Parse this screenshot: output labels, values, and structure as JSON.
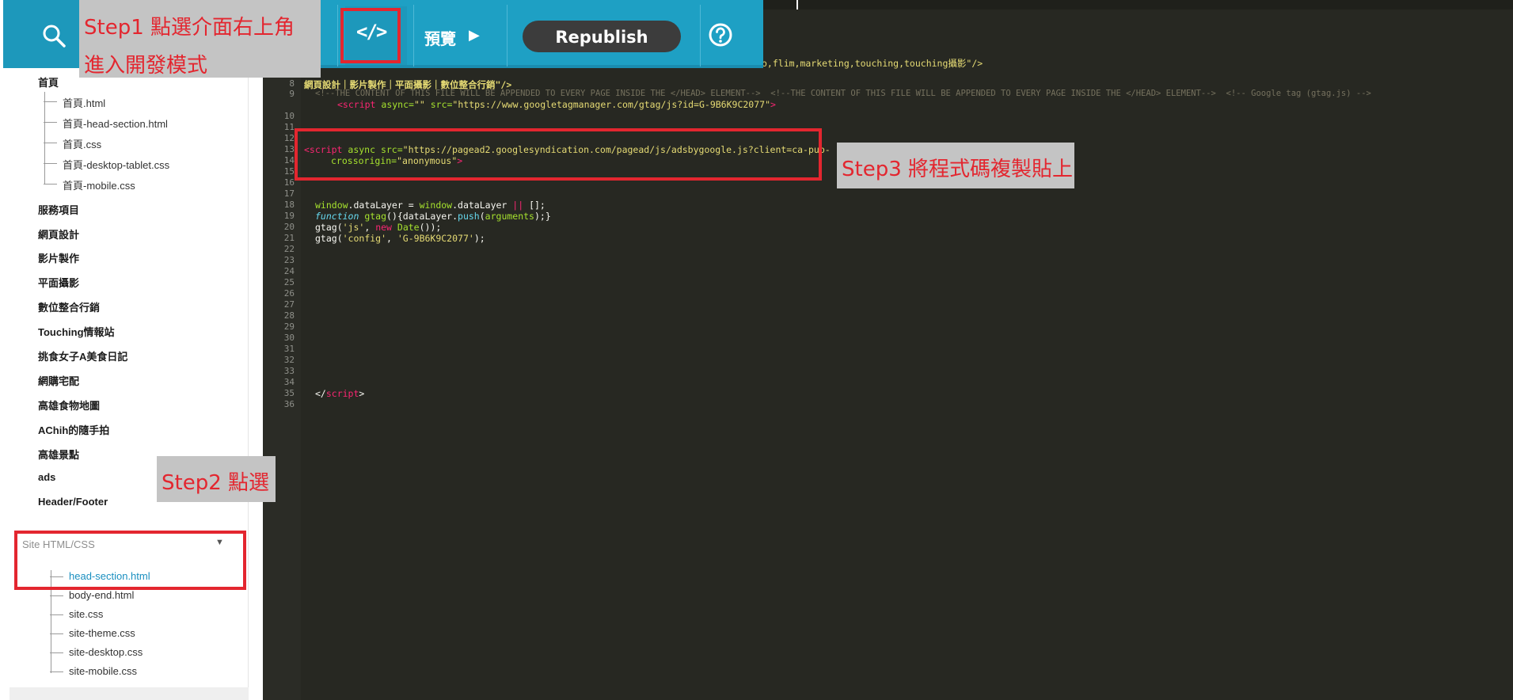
{
  "toolbar": {
    "preview_label": "預覽",
    "republish_label": "Republish"
  },
  "sidebar": {
    "home_label": "首頁",
    "home_files": [
      "首頁.html",
      "首頁-head-section.html",
      "首頁.css",
      "首頁-desktop-tablet.css",
      "首頁-mobile.css"
    ],
    "nav_items": [
      "服務項目",
      "網頁設計",
      "影片製作",
      "平面攝影",
      "數位整合行銷",
      "Touching情報站",
      "挑食女子A美食日記",
      "網購宅配",
      "高雄食物地圖",
      "AChih的隨手拍",
      "高雄景點",
      "ads",
      "Header/Footer"
    ],
    "site_section_label": "Site HTML/CSS",
    "site_files": [
      "head-section.html",
      "body-end.html",
      "site.css",
      "site-theme.css",
      "site-desktop.css",
      "site-mobile.css"
    ],
    "active_file": "head-section.html"
  },
  "annotations": {
    "step1_line1": "Step1 點選介面右上角",
    "step1_line2": "進入開發模式",
    "step2": "Step2 點選",
    "step3": "Step3 將程式碼複製貼上"
  },
  "editor": {
    "line_numbers": [
      "8",
      "9",
      "10",
      "11",
      "12",
      "13",
      "14",
      "15",
      "16",
      "17",
      "18",
      "19",
      "20",
      "21",
      "22",
      "23",
      "24",
      "25",
      "26",
      "27",
      "28",
      "29",
      "30",
      "31",
      "32",
      "33",
      "34",
      "35",
      "36"
    ],
    "line7_tail": "o,flim,marketing,touching,touching攝影\"/>",
    "line8_text": "網頁設計｜影片製作｜平面攝影｜數位整合行銷\"/>",
    "line9_comment": "<!--THE CONTENT OF THIS FILE WILL BE APPENDED TO EVERY PAGE INSIDE THE </HEAD> ELEMENT-->  <!--THE CONTENT OF THIS FILE WILL BE APPENDED TO EVERY PAGE INSIDE THE </HEAD> ELEMENT-->  <!-- Google tag (gtag.js) -->",
    "line9b": {
      "tag": "<script",
      "attr_async": " async=",
      "async_val": "\"\"",
      "attr_src": " src=",
      "src_val": "\"https://www.googletagmanager.com/gtag/js?id=G-9B6K9C2077\"",
      "close": ">"
    },
    "line13": {
      "tag": "<script",
      "attr_async": " async",
      "attr_src": " src=",
      "src_val": "\"https://pagead2.googlesyndication.com/pagead/js/adsbygoogle.js?client=ca-pub-"
    },
    "line14": {
      "attr": "crossorigin=",
      "val": "\"anonymous\"",
      "close": ">"
    },
    "line18": {
      "a": "window",
      "b": ".dataLayer = ",
      "c": "window",
      "d": ".dataLayer ",
      "e": "||",
      "f": " [];"
    },
    "line19": {
      "kw": "function",
      "fn": " gtag",
      "rest1": "(){dataLayer.",
      "push": "push",
      "rest2": "(",
      "args": "arguments",
      "rest3": ");}"
    },
    "line20": {
      "a": "gtag(",
      "s1": "'js'",
      "b": ", ",
      "kw": "new",
      "c": " ",
      "fn": "Date",
      "d": "());"
    },
    "line21": {
      "a": "gtag(",
      "s1": "'config'",
      "b": ", ",
      "s2": "'G-9B6K9C2077'",
      "c": ");"
    },
    "line35": {
      "open": "</",
      "tag": "script",
      "close": ">"
    }
  },
  "colors": {
    "toolbar": "#1ea0c4",
    "editor_bg": "#272822",
    "highlight": "#e3262f",
    "annotation_bg": "#c4c4c4",
    "active_file": "#1a8fc0"
  },
  "icons": [
    "search-icon",
    "code-icon",
    "play-icon",
    "help-icon",
    "chevron-down-icon"
  ]
}
